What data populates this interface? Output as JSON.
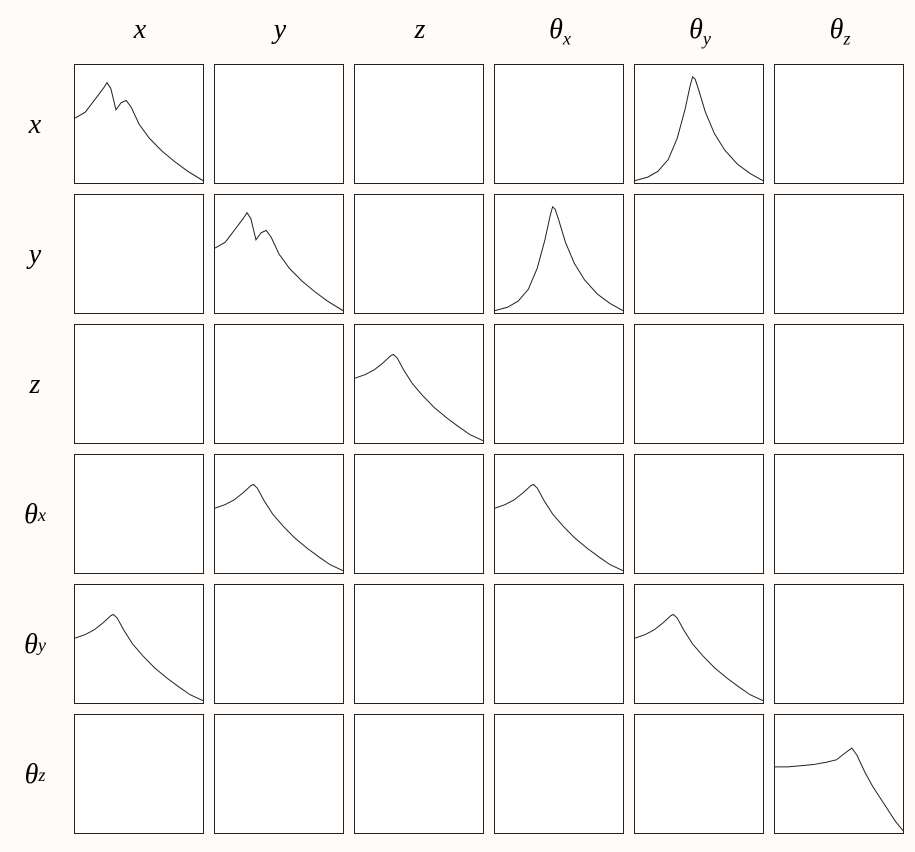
{
  "labels": {
    "x": "x",
    "y": "y",
    "z": "z",
    "theta": "θ",
    "theta_x_sub": "x",
    "theta_y_sub": "y",
    "theta_z_sub": "z"
  },
  "chart_data": {
    "type": "heatmap",
    "title": "",
    "axes": [
      "x",
      "y",
      "z",
      "θx",
      "θy",
      "θz"
    ],
    "description": "6×6 matrix of small plots (frequency-response / cross-spectra style). Each occupied cell shows a normalized curve on a 0–1 × 0–1 internal axis. Empty cells indicate no significant coupling. Curve shapes: A = two-peak ridge with decaying tail (peak ~0.85 at x≈0.25, secondary peak ~0.70 at x≈0.40); B = single sharp peak near center (~0.90 at x≈0.45) with symmetric rise/fall; C = single peak near x≈0.30 (~0.75) with long decaying tail; D = late peak near x≈0.60 (~0.72) with preceding gentle rise and decaying tail.",
    "cells": [
      {
        "row": "x",
        "col": "x",
        "shape": "A"
      },
      {
        "row": "x",
        "col": "θy",
        "shape": "B"
      },
      {
        "row": "y",
        "col": "y",
        "shape": "A"
      },
      {
        "row": "y",
        "col": "θx",
        "shape": "B"
      },
      {
        "row": "z",
        "col": "z",
        "shape": "C"
      },
      {
        "row": "θx",
        "col": "y",
        "shape": "C"
      },
      {
        "row": "θx",
        "col": "θx",
        "shape": "C"
      },
      {
        "row": "θy",
        "col": "x",
        "shape": "C"
      },
      {
        "row": "θy",
        "col": "θy",
        "shape": "C"
      },
      {
        "row": "θz",
        "col": "θz",
        "shape": "D"
      }
    ],
    "curve_shapes": {
      "A": [
        {
          "x": 0.0,
          "y": 0.55
        },
        {
          "x": 0.08,
          "y": 0.6
        },
        {
          "x": 0.15,
          "y": 0.7
        },
        {
          "x": 0.22,
          "y": 0.8
        },
        {
          "x": 0.25,
          "y": 0.85
        },
        {
          "x": 0.28,
          "y": 0.8
        },
        {
          "x": 0.32,
          "y": 0.62
        },
        {
          "x": 0.36,
          "y": 0.68
        },
        {
          "x": 0.4,
          "y": 0.7
        },
        {
          "x": 0.44,
          "y": 0.64
        },
        {
          "x": 0.5,
          "y": 0.5
        },
        {
          "x": 0.58,
          "y": 0.38
        },
        {
          "x": 0.68,
          "y": 0.27
        },
        {
          "x": 0.78,
          "y": 0.18
        },
        {
          "x": 0.88,
          "y": 0.1
        },
        {
          "x": 1.0,
          "y": 0.02
        }
      ],
      "B": [
        {
          "x": 0.0,
          "y": 0.02
        },
        {
          "x": 0.1,
          "y": 0.05
        },
        {
          "x": 0.18,
          "y": 0.1
        },
        {
          "x": 0.26,
          "y": 0.2
        },
        {
          "x": 0.33,
          "y": 0.38
        },
        {
          "x": 0.39,
          "y": 0.62
        },
        {
          "x": 0.43,
          "y": 0.82
        },
        {
          "x": 0.45,
          "y": 0.9
        },
        {
          "x": 0.47,
          "y": 0.88
        },
        {
          "x": 0.5,
          "y": 0.78
        },
        {
          "x": 0.55,
          "y": 0.6
        },
        {
          "x": 0.62,
          "y": 0.42
        },
        {
          "x": 0.7,
          "y": 0.28
        },
        {
          "x": 0.8,
          "y": 0.16
        },
        {
          "x": 0.9,
          "y": 0.08
        },
        {
          "x": 1.0,
          "y": 0.02
        }
      ],
      "C": [
        {
          "x": 0.0,
          "y": 0.55
        },
        {
          "x": 0.08,
          "y": 0.58
        },
        {
          "x": 0.15,
          "y": 0.62
        },
        {
          "x": 0.22,
          "y": 0.68
        },
        {
          "x": 0.28,
          "y": 0.74
        },
        {
          "x": 0.3,
          "y": 0.75
        },
        {
          "x": 0.33,
          "y": 0.72
        },
        {
          "x": 0.38,
          "y": 0.62
        },
        {
          "x": 0.45,
          "y": 0.5
        },
        {
          "x": 0.53,
          "y": 0.4
        },
        {
          "x": 0.62,
          "y": 0.3
        },
        {
          "x": 0.72,
          "y": 0.21
        },
        {
          "x": 0.82,
          "y": 0.13
        },
        {
          "x": 0.9,
          "y": 0.07
        },
        {
          "x": 1.0,
          "y": 0.02
        }
      ],
      "D": [
        {
          "x": 0.0,
          "y": 0.56
        },
        {
          "x": 0.1,
          "y": 0.56
        },
        {
          "x": 0.2,
          "y": 0.57
        },
        {
          "x": 0.3,
          "y": 0.58
        },
        {
          "x": 0.4,
          "y": 0.6
        },
        {
          "x": 0.48,
          "y": 0.62
        },
        {
          "x": 0.55,
          "y": 0.68
        },
        {
          "x": 0.6,
          "y": 0.72
        },
        {
          "x": 0.64,
          "y": 0.66
        },
        {
          "x": 0.7,
          "y": 0.52
        },
        {
          "x": 0.76,
          "y": 0.4
        },
        {
          "x": 0.82,
          "y": 0.3
        },
        {
          "x": 0.88,
          "y": 0.2
        },
        {
          "x": 0.94,
          "y": 0.1
        },
        {
          "x": 1.0,
          "y": 0.02
        }
      ]
    }
  }
}
